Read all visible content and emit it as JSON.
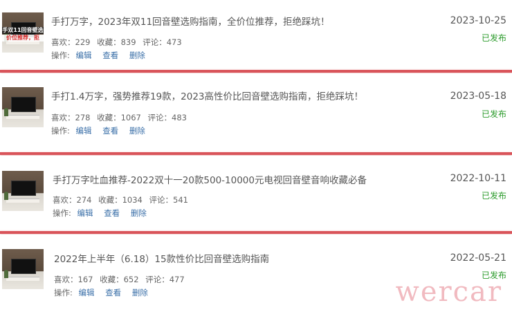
{
  "articles": [
    {
      "title": "手打万字，2023年双11回音壁选购指南，全价位推荐，拒绝踩坑！",
      "likes_label": "喜欢：229",
      "favs_label": "收藏：839",
      "comments_label": "评论：473",
      "ops_label": "操作:",
      "edit": "编辑",
      "view": "查看",
      "delete": "删除",
      "date": "2023-10-25",
      "status": "已发布",
      "thumb_text_1": "手双11回音壁选",
      "thumb_text_2": "价位推荐，拒"
    },
    {
      "title": "手打1.4万字，强势推荐19款，2023高性价比回音壁选购指南，拒绝踩坑！",
      "likes_label": "喜欢：278",
      "favs_label": "收藏：1067",
      "comments_label": "评论：483",
      "ops_label": "操作:",
      "edit": "编辑",
      "view": "查看",
      "delete": "删除",
      "date": "2023-05-18",
      "status": "已发布"
    },
    {
      "title": "手打万字吐血推荐-2022双十一20款500-10000元电视回音壁音响收藏必备",
      "likes_label": "喜欢：274",
      "favs_label": "收藏：1034",
      "comments_label": "评论：541",
      "ops_label": "操作:",
      "edit": "编辑",
      "view": "查看",
      "delete": "删除",
      "date": "2022-10-11",
      "status": "已发布"
    },
    {
      "title": "2022年上半年（6.18）15款性价比回音壁选购指南",
      "likes_label": "喜欢：167",
      "favs_label": "收藏：652",
      "comments_label": "评论：477",
      "ops_label": "操作:",
      "edit": "编辑",
      "view": "查看",
      "delete": "删除",
      "date": "2022-05-21",
      "status": "已发布"
    }
  ],
  "watermark": "wercar",
  "colors": {
    "separator": "#d9545a",
    "status_green": "#2a9a2a",
    "link_blue": "#3a6fa8"
  }
}
